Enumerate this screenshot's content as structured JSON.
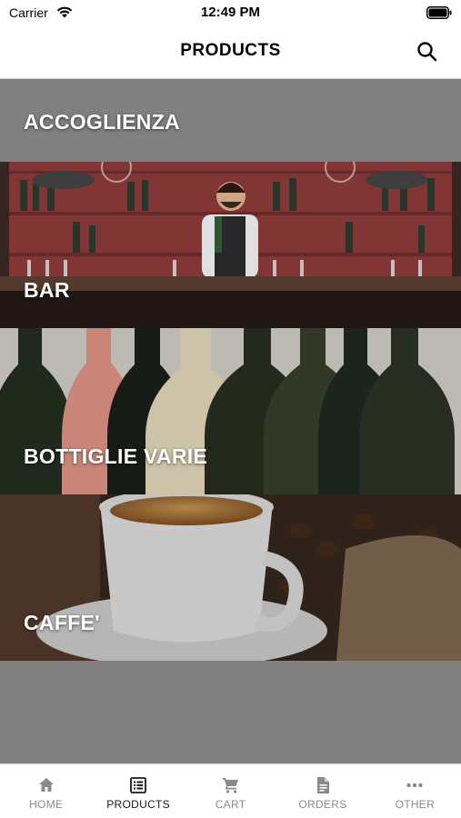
{
  "status_bar": {
    "carrier": "Carrier",
    "time": "12:49 PM"
  },
  "nav": {
    "title": "PRODUCTS",
    "search_icon": "search-icon"
  },
  "categories": [
    {
      "label": "ACCOGLIENZA"
    },
    {
      "label": "BAR"
    },
    {
      "label": "BOTTIGLIE VARIE"
    },
    {
      "label": "CAFFE'"
    }
  ],
  "tabs": [
    {
      "label": "HOME",
      "icon": "home-icon",
      "active": false
    },
    {
      "label": "PRODUCTS",
      "icon": "list-icon",
      "active": true
    },
    {
      "label": "CART",
      "icon": "cart-icon",
      "active": false
    },
    {
      "label": "ORDERS",
      "icon": "document-icon",
      "active": false
    },
    {
      "label": "OTHER",
      "icon": "more-icon",
      "active": false
    }
  ],
  "colors": {
    "background": "#808080",
    "active_tab": "#1a1a1a",
    "inactive_tab": "#8a8a8a"
  }
}
